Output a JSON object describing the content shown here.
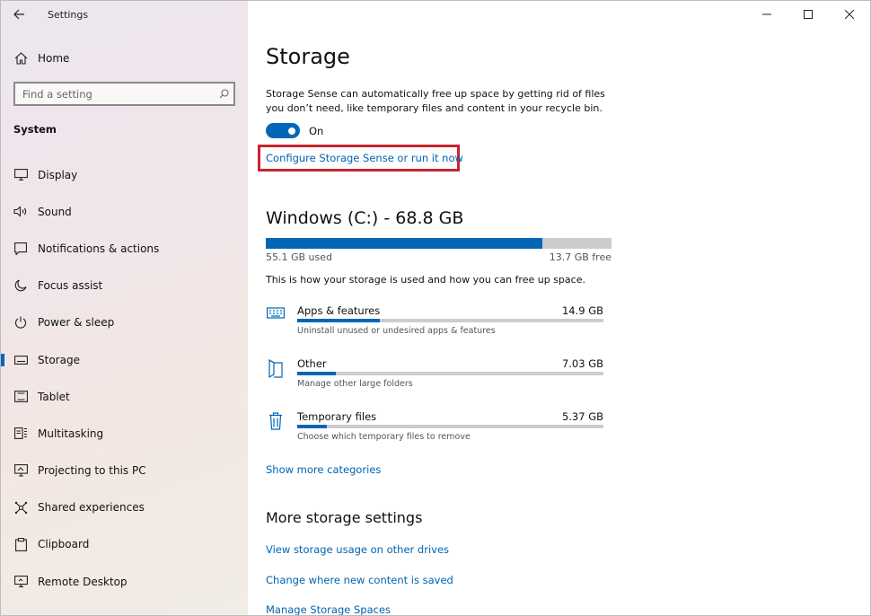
{
  "window": {
    "title": "Settings",
    "controls": {
      "minimize": "minimize-icon",
      "maximize": "maximize-icon",
      "close": "close-icon"
    }
  },
  "sidebar": {
    "home_label": "Home",
    "search_placeholder": "Find a setting",
    "section_title": "System",
    "items": [
      {
        "label": "Display",
        "icon": "display-icon"
      },
      {
        "label": "Sound",
        "icon": "sound-icon"
      },
      {
        "label": "Notifications & actions",
        "icon": "notifications-icon"
      },
      {
        "label": "Focus assist",
        "icon": "moon-icon"
      },
      {
        "label": "Power & sleep",
        "icon": "power-icon"
      },
      {
        "label": "Storage",
        "icon": "storage-icon",
        "selected": true
      },
      {
        "label": "Tablet",
        "icon": "tablet-icon"
      },
      {
        "label": "Multitasking",
        "icon": "multitasking-icon"
      },
      {
        "label": "Projecting to this PC",
        "icon": "projecting-icon"
      },
      {
        "label": "Shared experiences",
        "icon": "shared-experiences-icon"
      },
      {
        "label": "Clipboard",
        "icon": "clipboard-icon"
      },
      {
        "label": "Remote Desktop",
        "icon": "remote-desktop-icon"
      }
    ]
  },
  "main": {
    "title": "Storage",
    "description": "Storage Sense can automatically free up space by getting rid of files you don’t need, like temporary files and content in your recycle bin.",
    "toggle": {
      "state_label": "On",
      "on": true
    },
    "configure_link": "Configure Storage Sense or run it now",
    "drive": {
      "title": "Windows (C:) - 68.8 GB",
      "used_label": "55.1 GB used",
      "free_label": "13.7 GB free",
      "used_fraction": 0.801
    },
    "usage_text": "This is how your storage is used and how you can free up space.",
    "categories": [
      {
        "name": "Apps & features",
        "size": "14.9 GB",
        "subtitle": "Uninstall unused or undesired apps & features",
        "fraction": 0.27,
        "icon": "apps-features-icon"
      },
      {
        "name": "Other",
        "size": "7.03 GB",
        "subtitle": "Manage other large folders",
        "fraction": 0.127,
        "icon": "other-folder-icon"
      },
      {
        "name": "Temporary files",
        "size": "5.37 GB",
        "subtitle": "Choose which temporary files to remove",
        "fraction": 0.097,
        "icon": "trash-icon"
      }
    ],
    "show_more": "Show more categories",
    "more_settings": {
      "title": "More storage settings",
      "links": [
        "View storage usage on other drives",
        "Change where new content is saved",
        "Manage Storage Spaces"
      ]
    }
  },
  "colors": {
    "accent": "#0067b8",
    "link": "#0063b1",
    "highlight": "#c9232c",
    "bar_track": "#cccccc"
  }
}
